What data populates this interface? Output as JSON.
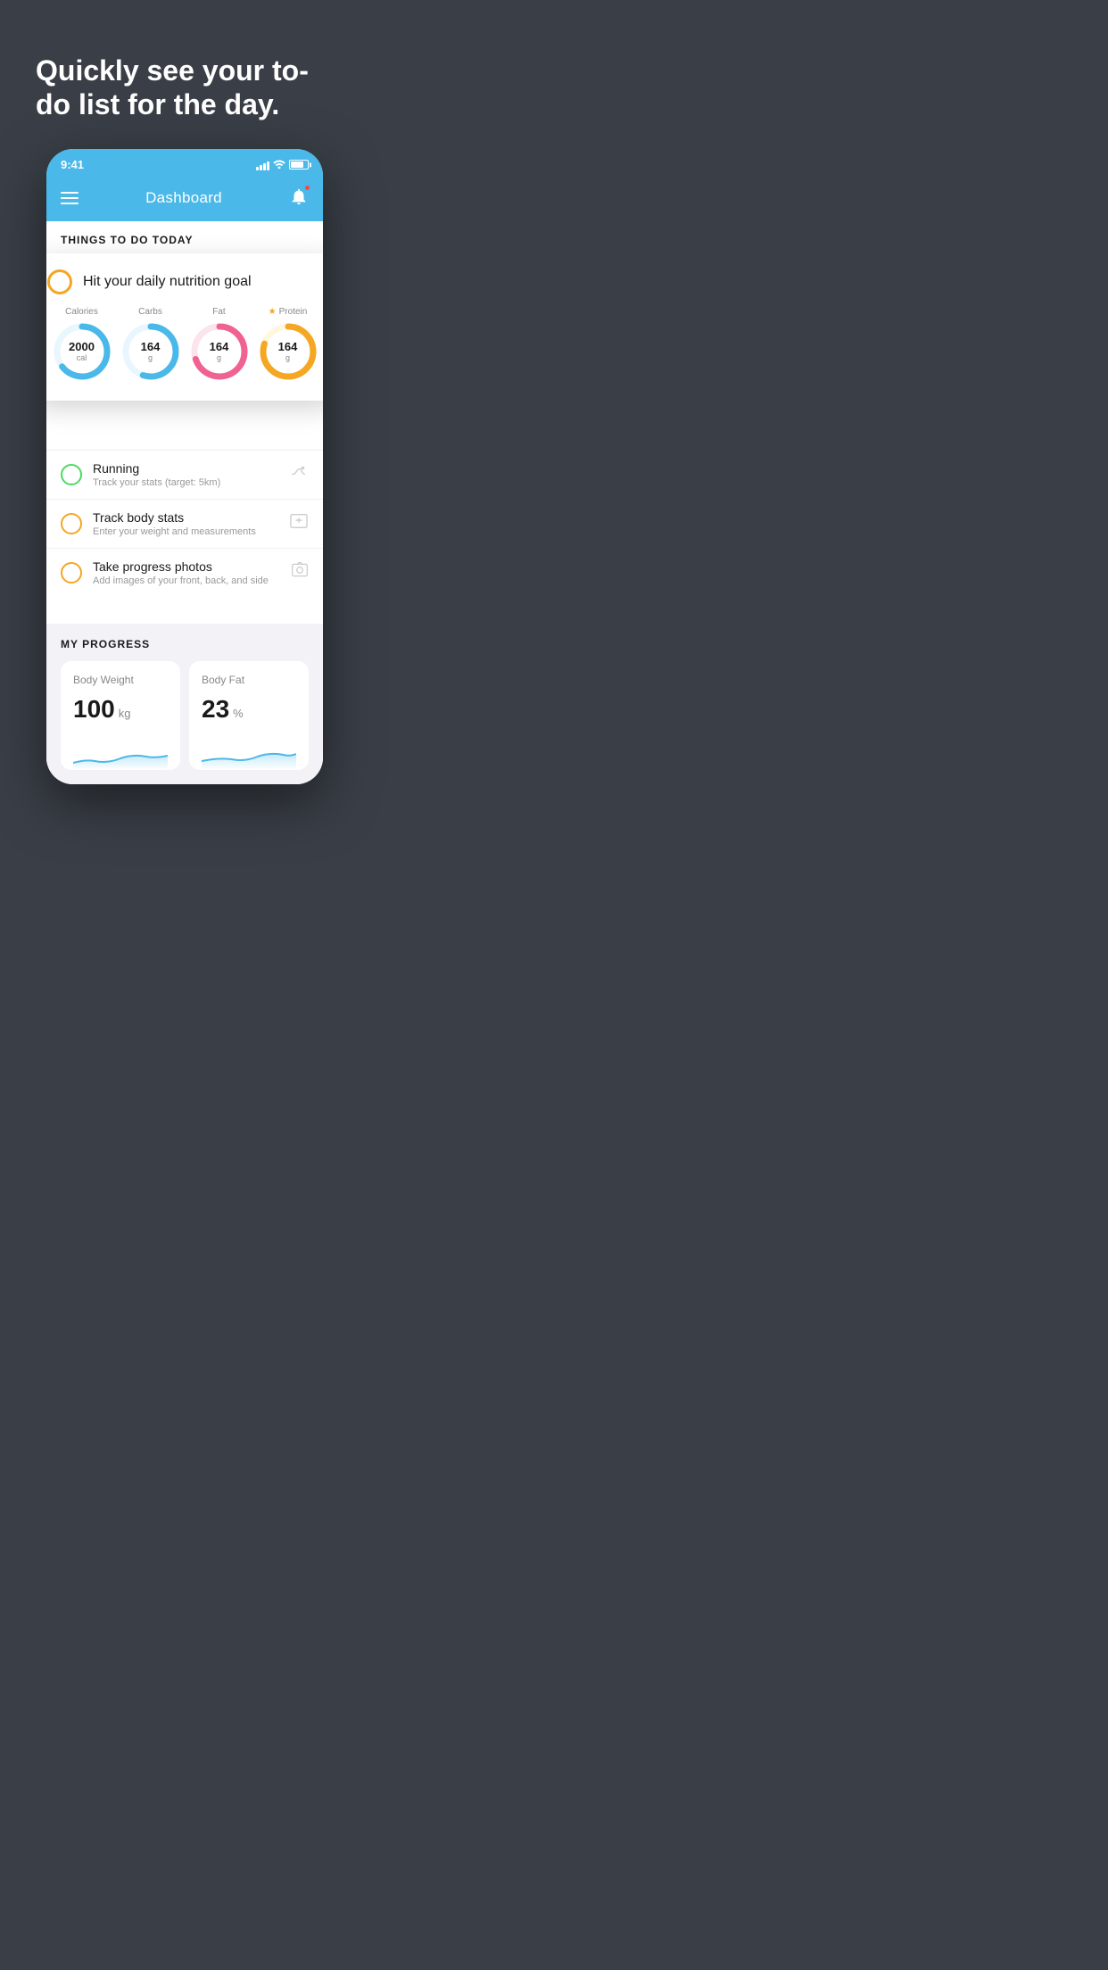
{
  "hero": {
    "title": "Quickly see your to-do list for the day."
  },
  "statusBar": {
    "time": "9:41",
    "batteryLevel": "80"
  },
  "header": {
    "title": "Dashboard"
  },
  "section1": {
    "label": "THINGS TO DO TODAY"
  },
  "popupCard": {
    "title": "Hit your daily nutrition goal",
    "nutrients": [
      {
        "label": "Calories",
        "value": "2000",
        "unit": "cal",
        "color": "#4ab8e8",
        "trackColor": "#e8f7fd",
        "percent": 65,
        "starred": false
      },
      {
        "label": "Carbs",
        "value": "164",
        "unit": "g",
        "color": "#4ab8e8",
        "trackColor": "#e8f7fd",
        "percent": 55,
        "starred": false
      },
      {
        "label": "Fat",
        "value": "164",
        "unit": "g",
        "color": "#f06292",
        "trackColor": "#fce4ec",
        "percent": 70,
        "starred": false
      },
      {
        "label": "Protein",
        "value": "164",
        "unit": "g",
        "color": "#f5a623",
        "trackColor": "#fff8e1",
        "percent": 80,
        "starred": true
      }
    ]
  },
  "todoItems": [
    {
      "title": "Running",
      "subtitle": "Track your stats (target: 5km)",
      "circleColor": "green",
      "icon": "👟"
    },
    {
      "title": "Track body stats",
      "subtitle": "Enter your weight and measurements",
      "circleColor": "yellow",
      "icon": "⚖️"
    },
    {
      "title": "Take progress photos",
      "subtitle": "Add images of your front, back, and side",
      "circleColor": "yellow2",
      "icon": "🖼️"
    }
  ],
  "progressSection": {
    "title": "MY PROGRESS",
    "cards": [
      {
        "title": "Body Weight",
        "value": "100",
        "unit": "kg"
      },
      {
        "title": "Body Fat",
        "value": "23",
        "unit": "%"
      }
    ]
  }
}
